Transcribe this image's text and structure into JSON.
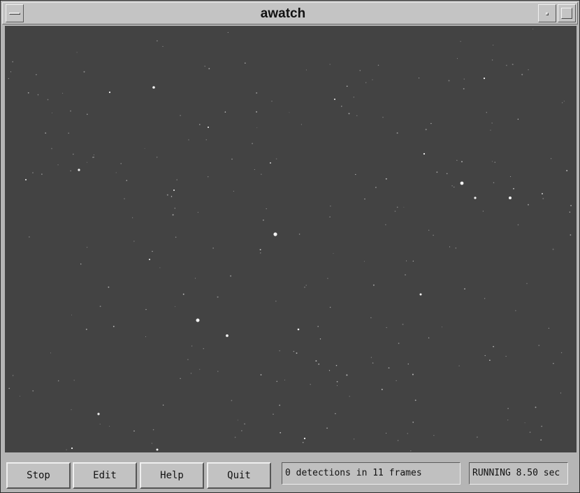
{
  "window": {
    "title": "awatch"
  },
  "image": {
    "background_color": "#434343",
    "star_color": "#f2f2f2"
  },
  "controls": {
    "stop_label": "Stop",
    "edit_label": "Edit",
    "help_label": "Help",
    "quit_label": "Quit"
  },
  "status": {
    "detections": "0 detections in 11 frames",
    "state": "RUNNING 8.50 sec"
  },
  "icons": {
    "window_menu": "window-menu-icon",
    "minimize": "minimize-icon",
    "maximize": "maximize-icon"
  }
}
